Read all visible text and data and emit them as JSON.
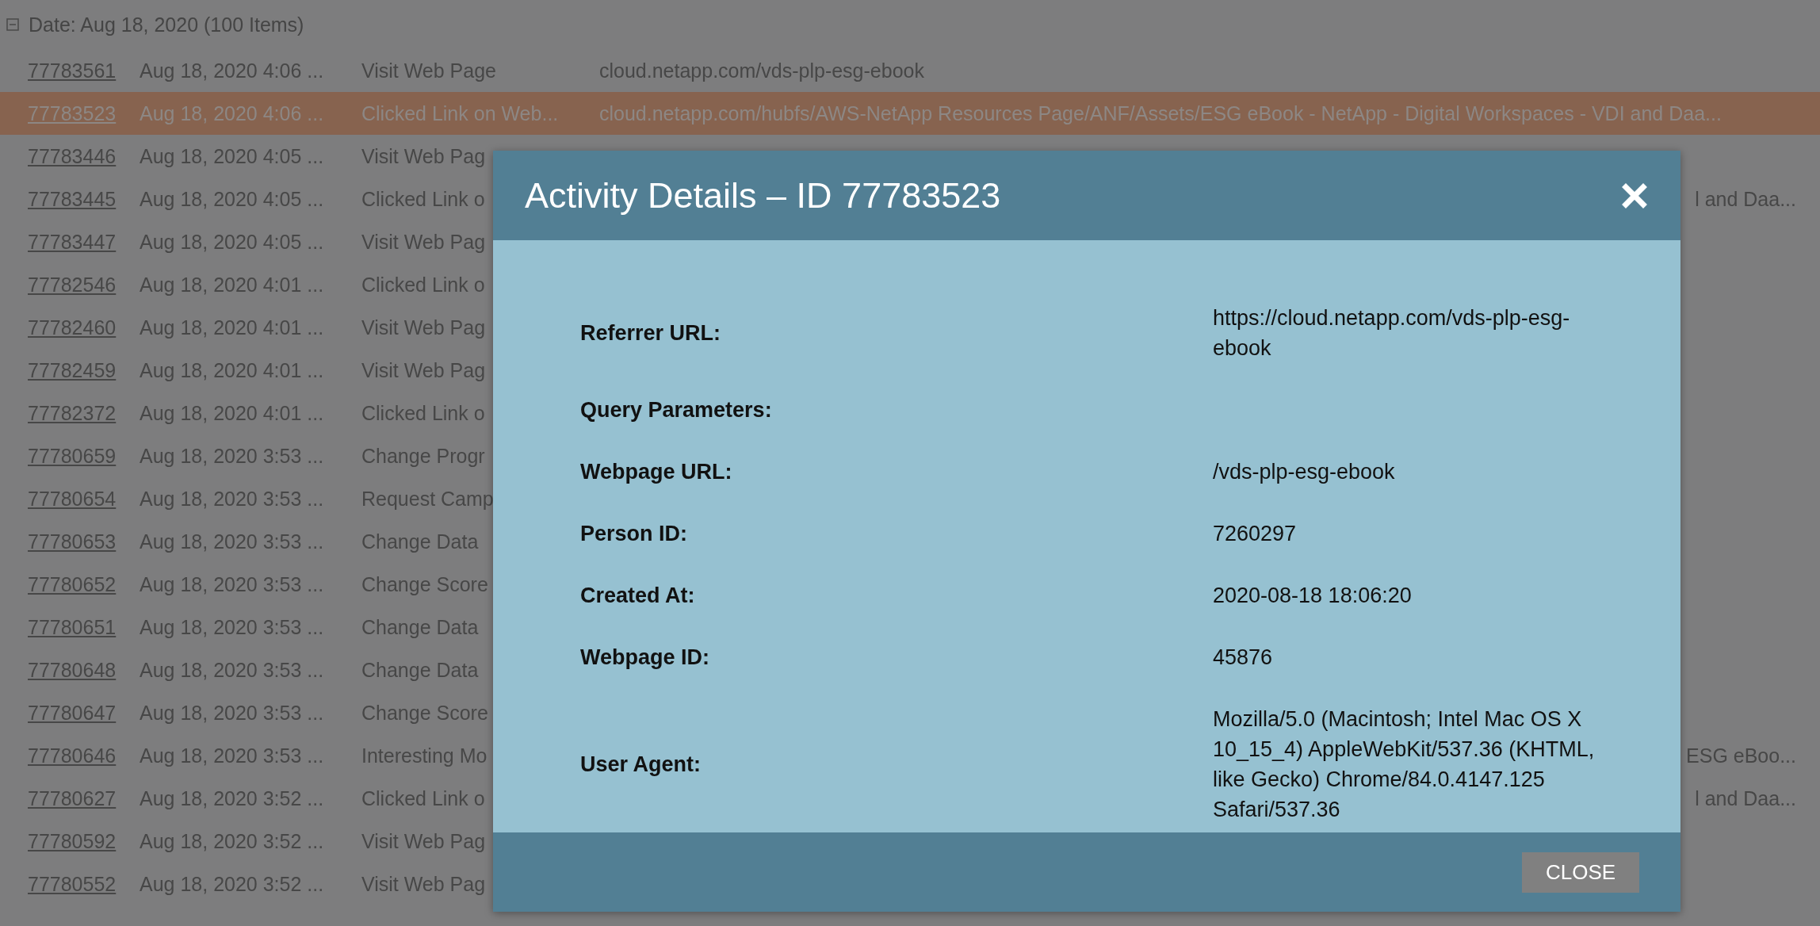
{
  "group": {
    "label": "Date: Aug 18, 2020 (100 Items)",
    "expanded": true
  },
  "rows": [
    {
      "id": "77783561",
      "date": "Aug 18, 2020 4:06 ...",
      "type": "Visit Web Page",
      "detail": "cloud.netapp.com/vds-plp-esg-ebook",
      "selected": false
    },
    {
      "id": "77783523",
      "date": "Aug 18, 2020 4:06 ...",
      "type": "Clicked Link on Web...",
      "detail": "cloud.netapp.com/hubfs/AWS-NetApp Resources Page/ANF/Assets/ESG eBook - NetApp - Digital Workspaces - VDI and Daa...",
      "selected": true
    },
    {
      "id": "77783446",
      "date": "Aug 18, 2020 4:05 ...",
      "type": "Visit Web Pag",
      "selected": false
    },
    {
      "id": "77783445",
      "date": "Aug 18, 2020 4:05 ...",
      "type": "Clicked Link o",
      "detail_tail": "l and Daa...",
      "selected": false
    },
    {
      "id": "77783447",
      "date": "Aug 18, 2020 4:05 ...",
      "type": "Visit Web Pag",
      "selected": false
    },
    {
      "id": "77782546",
      "date": "Aug 18, 2020 4:01 ...",
      "type": "Clicked Link o",
      "selected": false
    },
    {
      "id": "77782460",
      "date": "Aug 18, 2020 4:01 ...",
      "type": "Visit Web Pag",
      "selected": false
    },
    {
      "id": "77782459",
      "date": "Aug 18, 2020 4:01 ...",
      "type": "Visit Web Pag",
      "selected": false
    },
    {
      "id": "77782372",
      "date": "Aug 18, 2020 4:01 ...",
      "type": "Clicked Link o",
      "selected": false
    },
    {
      "id": "77780659",
      "date": "Aug 18, 2020 3:53 ...",
      "type": "Change Progr",
      "selected": false
    },
    {
      "id": "77780654",
      "date": "Aug 18, 2020 3:53 ...",
      "type": "Request Camp",
      "selected": false
    },
    {
      "id": "77780653",
      "date": "Aug 18, 2020 3:53 ...",
      "type": "Change Data",
      "selected": false
    },
    {
      "id": "77780652",
      "date": "Aug 18, 2020 3:53 ...",
      "type": "Change Score",
      "selected": false
    },
    {
      "id": "77780651",
      "date": "Aug 18, 2020 3:53 ...",
      "type": "Change Data",
      "selected": false
    },
    {
      "id": "77780648",
      "date": "Aug 18, 2020 3:53 ...",
      "type": "Change Data",
      "selected": false
    },
    {
      "id": "77780647",
      "date": "Aug 18, 2020 3:53 ...",
      "type": "Change Score",
      "selected": false
    },
    {
      "id": "77780646",
      "date": "Aug 18, 2020 3:53 ...",
      "type": "Interesting Mo",
      "detail_tail": "ESG eBoo...",
      "selected": false
    },
    {
      "id": "77780627",
      "date": "Aug 18, 2020 3:52 ...",
      "type": "Clicked Link o",
      "detail_tail": "l and Daa...",
      "selected": false
    },
    {
      "id": "77780592",
      "date": "Aug 18, 2020 3:52 ...",
      "type": "Visit Web Pag",
      "selected": false
    },
    {
      "id": "77780552",
      "date": "Aug 18, 2020 3:52 ...",
      "type": "Visit Web Pag",
      "selected": false
    }
  ],
  "dialog": {
    "title": "Activity Details – ID 77783523",
    "fields": [
      {
        "label": "Referrer URL:",
        "value": "https://cloud.netapp.com/vds-plp-esg-ebook"
      },
      {
        "label": "Query Parameters:"
      },
      {
        "label": "Webpage URL:",
        "value": "/vds-plp-esg-ebook"
      },
      {
        "label": "Person ID:",
        "value": "7260297"
      },
      {
        "label": "Created At:",
        "value": "2020-08-18 18:06:20"
      },
      {
        "label": "Webpage ID:",
        "value": "45876"
      },
      {
        "label": "User Agent:",
        "value": "Mozilla/5.0 (Macintosh; Intel Mac OS X 10_15_4) AppleWebKit/537.36 (KHTML, like Gecko) Chrome/84.0.4147.125 Safari/537.36"
      }
    ],
    "close_button": "CLOSE"
  }
}
